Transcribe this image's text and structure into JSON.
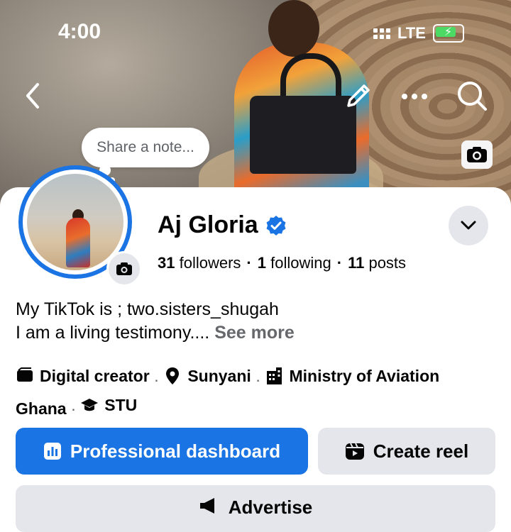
{
  "status_bar": {
    "time": "4:00",
    "network": "LTE"
  },
  "cover": {
    "note_placeholder": "Share a note..."
  },
  "profile": {
    "name": "Aj Gloria",
    "followers_count": "31",
    "followers_label": "followers",
    "following_count": "1",
    "following_label": "following",
    "posts_count": "11",
    "posts_label": "posts",
    "bio_line1": "My TikTok is ; two.sisters_shugah",
    "bio_line2": "I am a living testimony....",
    "see_more": "See more"
  },
  "details": {
    "category": "Digital creator",
    "location": "Sunyani",
    "work_part1": "Ministry of Aviation",
    "work_part2": "Ghana",
    "education": "STU"
  },
  "buttons": {
    "professional_dashboard": "Professional dashboard",
    "create_reel": "Create reel",
    "advertise": "Advertise"
  },
  "colors": {
    "accent": "#1b74e4",
    "button_gray": "#e4e6eb",
    "battery": "#4cd964"
  },
  "icons": [
    "back-icon",
    "edit-pencil-icon",
    "more-icon",
    "search-icon",
    "camera-icon",
    "verified-badge-icon",
    "chevron-down-icon",
    "category-icon",
    "location-pin-icon",
    "work-building-icon",
    "education-cap-icon",
    "dashboard-icon",
    "reel-icon",
    "megaphone-icon"
  ]
}
